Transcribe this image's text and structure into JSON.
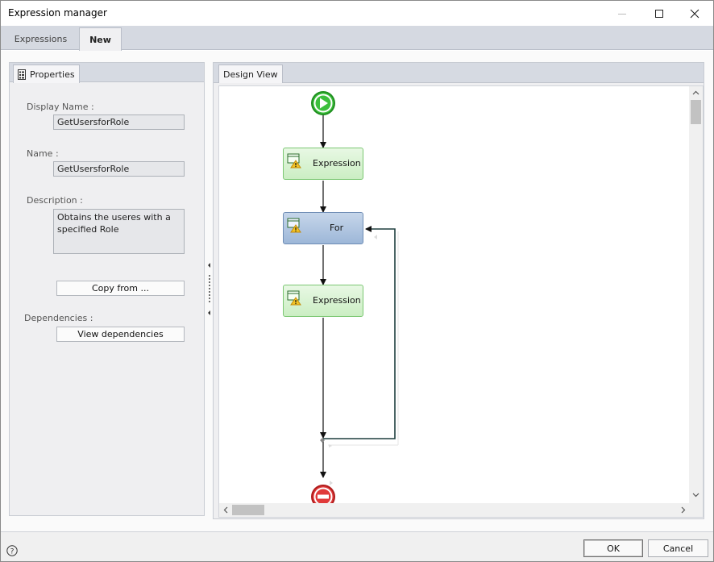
{
  "window": {
    "title": "Expression manager"
  },
  "tabs": [
    {
      "label": "Expressions"
    },
    {
      "label": "New"
    }
  ],
  "properties": {
    "tab_label": "Properties",
    "display_name_label": "Display Name :",
    "display_name_value": "GetUsersforRole",
    "name_label": "Name :",
    "name_value": "GetUsersforRole",
    "description_label": "Description :",
    "description_value": "Obtains the useres with a specified Role",
    "copy_from_label": "Copy from ...",
    "dependencies_label": "Dependencies :",
    "view_dependencies_label": "View dependencies"
  },
  "design_view": {
    "tab_label": "Design View",
    "nodes": [
      {
        "label": "Expression",
        "kind": "expression"
      },
      {
        "label": "For",
        "kind": "for"
      },
      {
        "label": "Expression",
        "kind": "expression"
      }
    ],
    "colors": {
      "expression_fill": "#cbeec3",
      "for_fill": "#9db7d8",
      "start": "#2eaa2e",
      "stop": "#d7262b"
    }
  },
  "footer": {
    "ok_label": "OK",
    "cancel_label": "Cancel"
  }
}
